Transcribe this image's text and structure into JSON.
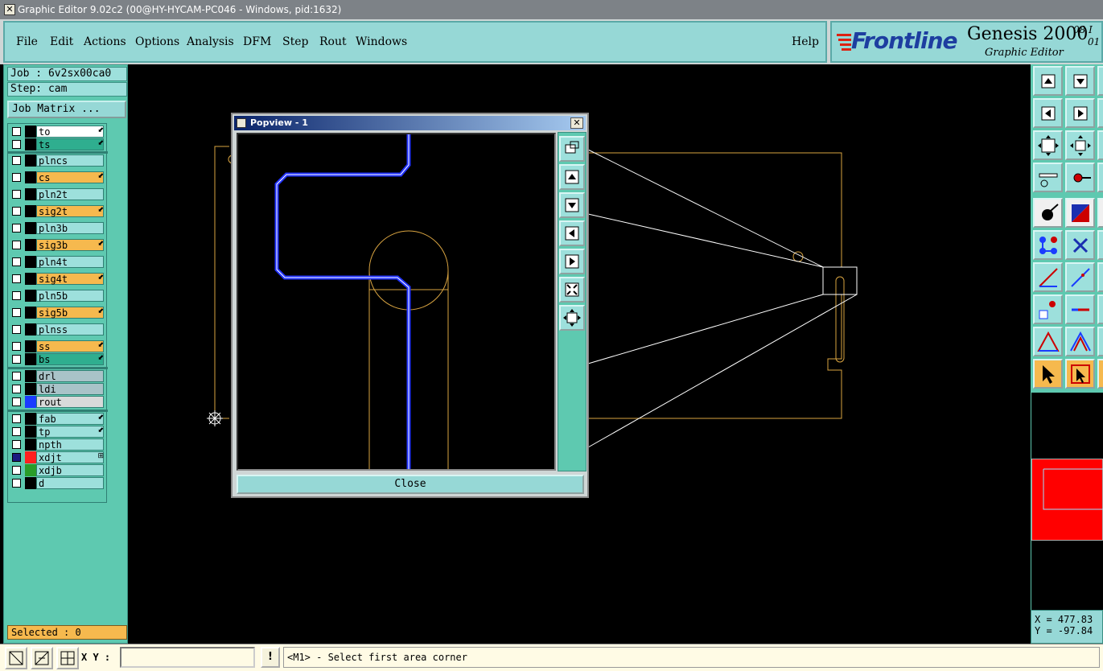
{
  "window": {
    "title": "Graphic Editor 9.02c2 (00@HY-HYCAM-PC046 - Windows, pid:1632)"
  },
  "menu": {
    "items": [
      "File",
      "Edit",
      "Actions",
      "Options",
      "Analysis",
      "DFM",
      "Step",
      "Rout",
      "Windows"
    ],
    "help": "Help"
  },
  "brand": {
    "logo": "Frontline",
    "product": "Genesis 2000",
    "subtitle": "Graphic Editor",
    "version_top": "08 I",
    "version_bottom": "01"
  },
  "left_panel": {
    "job": "Job : 6v2sx00ca0",
    "step": "Step: cam",
    "job_matrix": "Job Matrix ...",
    "selected": "Selected : 0"
  },
  "layers": [
    {
      "name": "to",
      "color": "#ffffff",
      "arrow": "⬋"
    },
    {
      "name": "ts",
      "color": "#2fae8f",
      "arrow": "⬋"
    },
    {
      "name": "plncs",
      "color": "#9de0dc",
      "arrow": ""
    },
    {
      "name": "cs",
      "color": "#f6b94e",
      "arrow": "⬋"
    },
    {
      "name": "pln2t",
      "color": "#9de0dc",
      "arrow": ""
    },
    {
      "name": "sig2t",
      "color": "#f6b94e",
      "arrow": "⬋"
    },
    {
      "name": "pln3b",
      "color": "#9de0dc",
      "arrow": ""
    },
    {
      "name": "sig3b",
      "color": "#f6b94e",
      "arrow": "⬋"
    },
    {
      "name": "pln4t",
      "color": "#9de0dc",
      "arrow": ""
    },
    {
      "name": "sig4t",
      "color": "#f6b94e",
      "arrow": "⬋"
    },
    {
      "name": "pln5b",
      "color": "#9de0dc",
      "arrow": ""
    },
    {
      "name": "sig5b",
      "color": "#f6b94e",
      "arrow": "⬋"
    },
    {
      "name": "plnss",
      "color": "#9de0dc",
      "arrow": ""
    },
    {
      "name": "ss",
      "color": "#f6b94e",
      "arrow": "⬋"
    },
    {
      "name": "bs",
      "color": "#2fae8f",
      "arrow": "⬋"
    },
    {
      "name": "drl",
      "color": "#a9c3c8",
      "arrow": ""
    },
    {
      "name": "ldi",
      "color": "#a9c3c8",
      "arrow": ""
    },
    {
      "name": "rout",
      "color": "#d8dada",
      "arrow": "",
      "swatch": "#1a3cff"
    },
    {
      "name": "fab",
      "color": "#9de0dc",
      "arrow": "⬋"
    },
    {
      "name": "tp",
      "color": "#9de0dc",
      "arrow": "⬋"
    },
    {
      "name": "npth",
      "color": "#9de0dc",
      "arrow": ""
    },
    {
      "name": "xdjt",
      "color": "#9de0dc",
      "arrow": "⊞",
      "swatch": "#ff2020",
      "checked": true
    },
    {
      "name": "xdjb",
      "color": "#9de0dc",
      "arrow": "",
      "swatch": "#2a9d2a"
    },
    {
      "name": "d",
      "color": "#9de0dc",
      "arrow": ""
    }
  ],
  "popview": {
    "title": "Popview - 1",
    "close_label": "Close",
    "close_x": "✕"
  },
  "coords": {
    "x": "X = 477.83",
    "y": "Y = -97.84"
  },
  "bottom": {
    "xy_label": "X Y :",
    "xy_value": "",
    "excl": "!",
    "status": "<M1> - Select first area corner"
  }
}
